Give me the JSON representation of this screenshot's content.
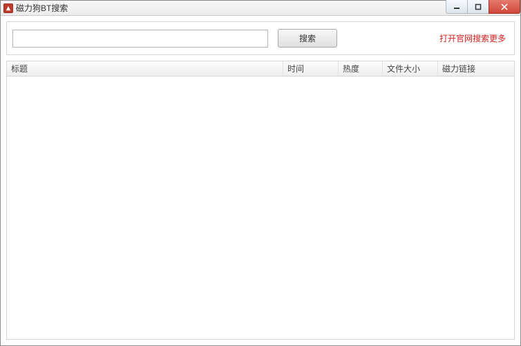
{
  "window": {
    "title": "磁力狗BT搜索"
  },
  "search": {
    "value": "",
    "placeholder": "",
    "button_label": "搜索",
    "open_site_label": "打开官网搜索更多"
  },
  "columns": {
    "title": "标题",
    "time": "时间",
    "heat": "热度",
    "size": "文件大小",
    "magnet": "磁力链接"
  },
  "results": []
}
